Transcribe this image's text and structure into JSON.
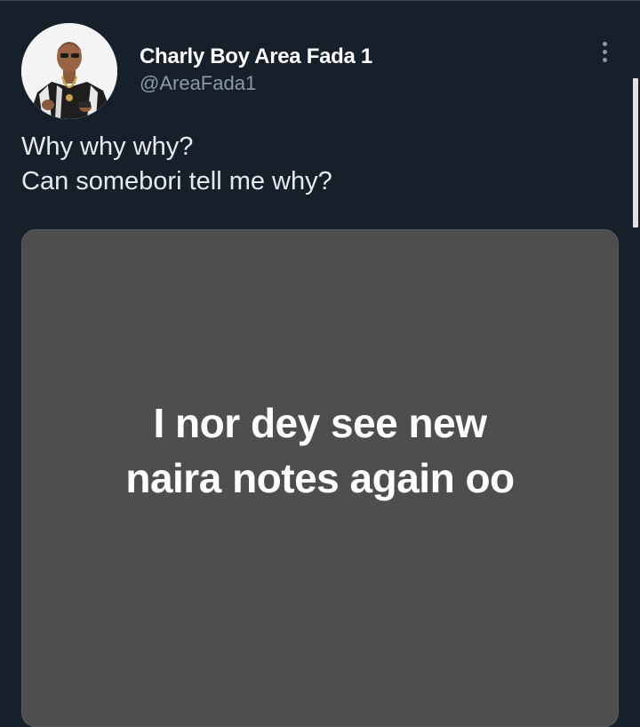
{
  "tweet": {
    "author": {
      "display_name": "Charly Boy Area Fada 1",
      "handle": "@AreaFada1",
      "avatar_icon": "profile-photo"
    },
    "more_icon": "more-vertical-icon",
    "text_lines": [
      "Why why why?",
      "Can somebori tell me why?"
    ],
    "media": {
      "text_lines": [
        "I nor dey see new",
        "naira notes again oo"
      ],
      "background": "#4e4e4e"
    }
  },
  "colors": {
    "background": "#15202b",
    "primary_text": "#e7e9ea",
    "secondary_text": "#8b98a5",
    "media_text": "#ffffff"
  }
}
